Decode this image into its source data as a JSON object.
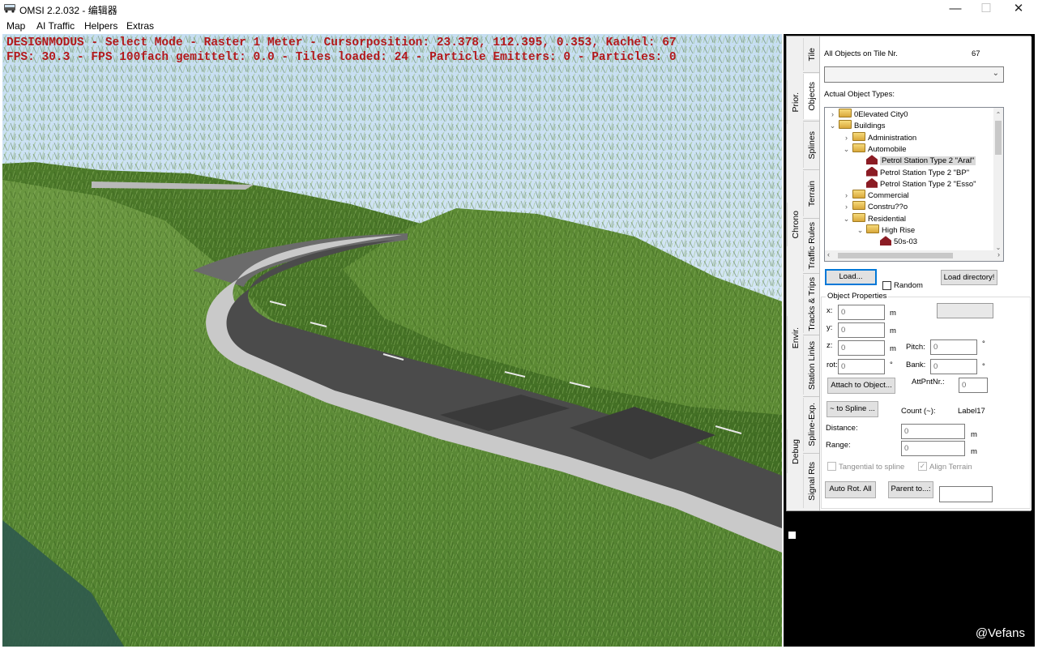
{
  "window": {
    "title": "OMSI 2.2.032 - 编辑器",
    "minimize": "—",
    "maximize": "☐",
    "close": "✕"
  },
  "menu": [
    "Map",
    "AI Traffic",
    "Helpers",
    "Extras"
  ],
  "hud": {
    "line1": "DESIGNMODUS - Select Mode - Raster 1 Meter - Cursorposition: 23.378, 112.395, 0.353, Kachel: 67",
    "line2": "FPS: 30.3 - FPS 100fach gemittelt: 0.0 - Tiles loaded: 24 - Particle Emitters: 0 - Particles: 0"
  },
  "watermark": "@Vefans",
  "tabs": {
    "outer": [
      "Prior.",
      "Chrono",
      "Envir.",
      "Debug"
    ],
    "inner": [
      "Tile",
      "Objects",
      "Splines",
      "Terrain",
      "Traffic Rules",
      "Tracks & Trips",
      "Station Links",
      "Spline-Exp.",
      "Signal Rts"
    ]
  },
  "objects_panel": {
    "tile_label": "All Objects on Tile Nr.",
    "tile_number": "67",
    "dropdown_value": "",
    "types_label": "Actual Object Types:",
    "tree": [
      {
        "label": "0Elevated City0",
        "level": 0,
        "icon": "folder-icon",
        "expander": "›"
      },
      {
        "label": "Buildings",
        "level": 0,
        "icon": "folder-icon",
        "expander": "⌄"
      },
      {
        "label": "Administration",
        "level": 1,
        "icon": "folder-icon",
        "expander": "›"
      },
      {
        "label": "Automobile",
        "level": 1,
        "icon": "folder-icon",
        "expander": "⌄"
      },
      {
        "label": "Petrol Station Type 2 \"Aral\"",
        "level": 2,
        "icon": "house-icon",
        "expander": "",
        "selected": true
      },
      {
        "label": "Petrol Station Type 2 \"BP\"",
        "level": 2,
        "icon": "house-icon",
        "expander": ""
      },
      {
        "label": "Petrol Station Type 2 \"Esso\"",
        "level": 2,
        "icon": "house-icon",
        "expander": ""
      },
      {
        "label": "Commercial",
        "level": 1,
        "icon": "folder-icon",
        "expander": "›"
      },
      {
        "label": "Constru??o",
        "level": 1,
        "icon": "folder-icon",
        "expander": "›"
      },
      {
        "label": "Residential",
        "level": 1,
        "icon": "folder-icon",
        "expander": "⌄"
      },
      {
        "label": "High Rise",
        "level": 2,
        "icon": "folder-icon",
        "expander": "⌄"
      },
      {
        "label": "50s-03",
        "level": 3,
        "icon": "house-icon",
        "expander": ""
      }
    ],
    "load_button": "Load...",
    "random_label": "Random",
    "load_dir_button": "Load directory!",
    "props_label": "Object Properties",
    "x_label": "x:",
    "x_value": "0",
    "y_label": "y:",
    "y_value": "0",
    "z_label": "z:",
    "z_value": "0",
    "rot_label": "rot:",
    "rot_value": "0",
    "unit_m": "m",
    "unit_deg": "°",
    "pitch_label": "Pitch:",
    "pitch_value": "0",
    "bank_label": "Bank:",
    "bank_value": "0",
    "attach_button": "Attach to Object...",
    "attpnt_label": "AttPntNr.:",
    "attpnt_value": "0",
    "spline_button": "~ to Spline ...",
    "count_label": "Count (~):",
    "count_value": "Label17",
    "distance_label": "Distance:",
    "distance_value": "0",
    "range_label": "Range:",
    "range_value": "0",
    "tangential_label": "Tangential to spline",
    "align_label": "Align Terrain",
    "autorot_button": "Auto Rot. All",
    "parent_button": "Parent to...:",
    "parent_value": ""
  }
}
